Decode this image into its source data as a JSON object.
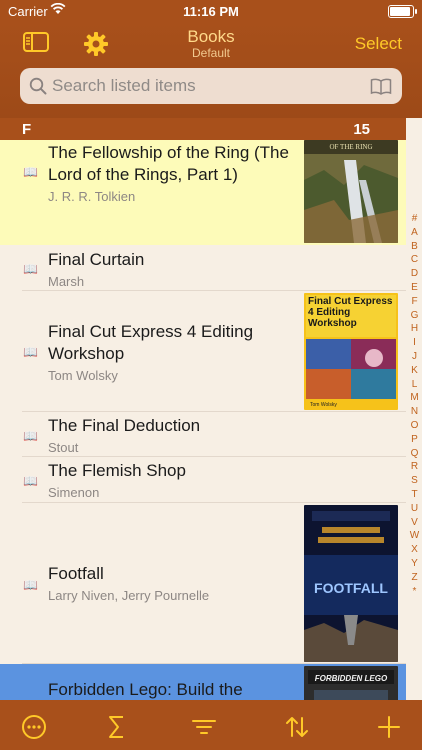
{
  "status_bar": {
    "carrier": "Carrier",
    "time": "11:16 PM"
  },
  "nav": {
    "title": "Books",
    "subtitle": "Default",
    "select_label": "Select",
    "left_icons": [
      "sidebar-icon",
      "gear-icon"
    ]
  },
  "search": {
    "placeholder": "Search listed items",
    "value": ""
  },
  "section": {
    "letter": "F",
    "count": "15"
  },
  "books": [
    {
      "title": "The Fellowship of the Ring (The Lord of the Rings, Part 1)",
      "author": "J. R. R. Tolkien",
      "cover_text": "OF THE RING",
      "highlight": "#fdfbb9"
    },
    {
      "title": "Final Curtain",
      "author": "Marsh"
    },
    {
      "title": "Final Cut Express 4 Editing Workshop",
      "author": "Tom Wolsky",
      "cover_text": "Final Cut Express 4 Editing Workshop",
      "cover_author": "Tom Wolsky"
    },
    {
      "title": "The Final Deduction",
      "author": "Stout"
    },
    {
      "title": "The Flemish Shop",
      "author": "Simenon"
    },
    {
      "title": "Footfall",
      "author": "Larry Niven, Jerry Pournelle",
      "cover_text": "FOOTFALL"
    },
    {
      "title": "Forbidden Lego: Build the",
      "author": "",
      "cover_text": "FORBIDDEN LEGO",
      "highlight": "#5b93e0"
    }
  ],
  "index_letters": [
    "#",
    "A",
    "B",
    "C",
    "D",
    "E",
    "F",
    "G",
    "H",
    "I",
    "J",
    "K",
    "L",
    "M",
    "N",
    "O",
    "P",
    "Q",
    "R",
    "S",
    "T",
    "U",
    "V",
    "W",
    "X",
    "Y",
    "Z",
    "*"
  ],
  "toolbar": [
    "more-icon",
    "sum-icon",
    "filter-icon",
    "sort-icon",
    "add-icon"
  ],
  "colors": {
    "bar": "#a8501b",
    "accent": "#ffc928",
    "list_bg": "#f7efe4",
    "index": "#c0631e"
  }
}
